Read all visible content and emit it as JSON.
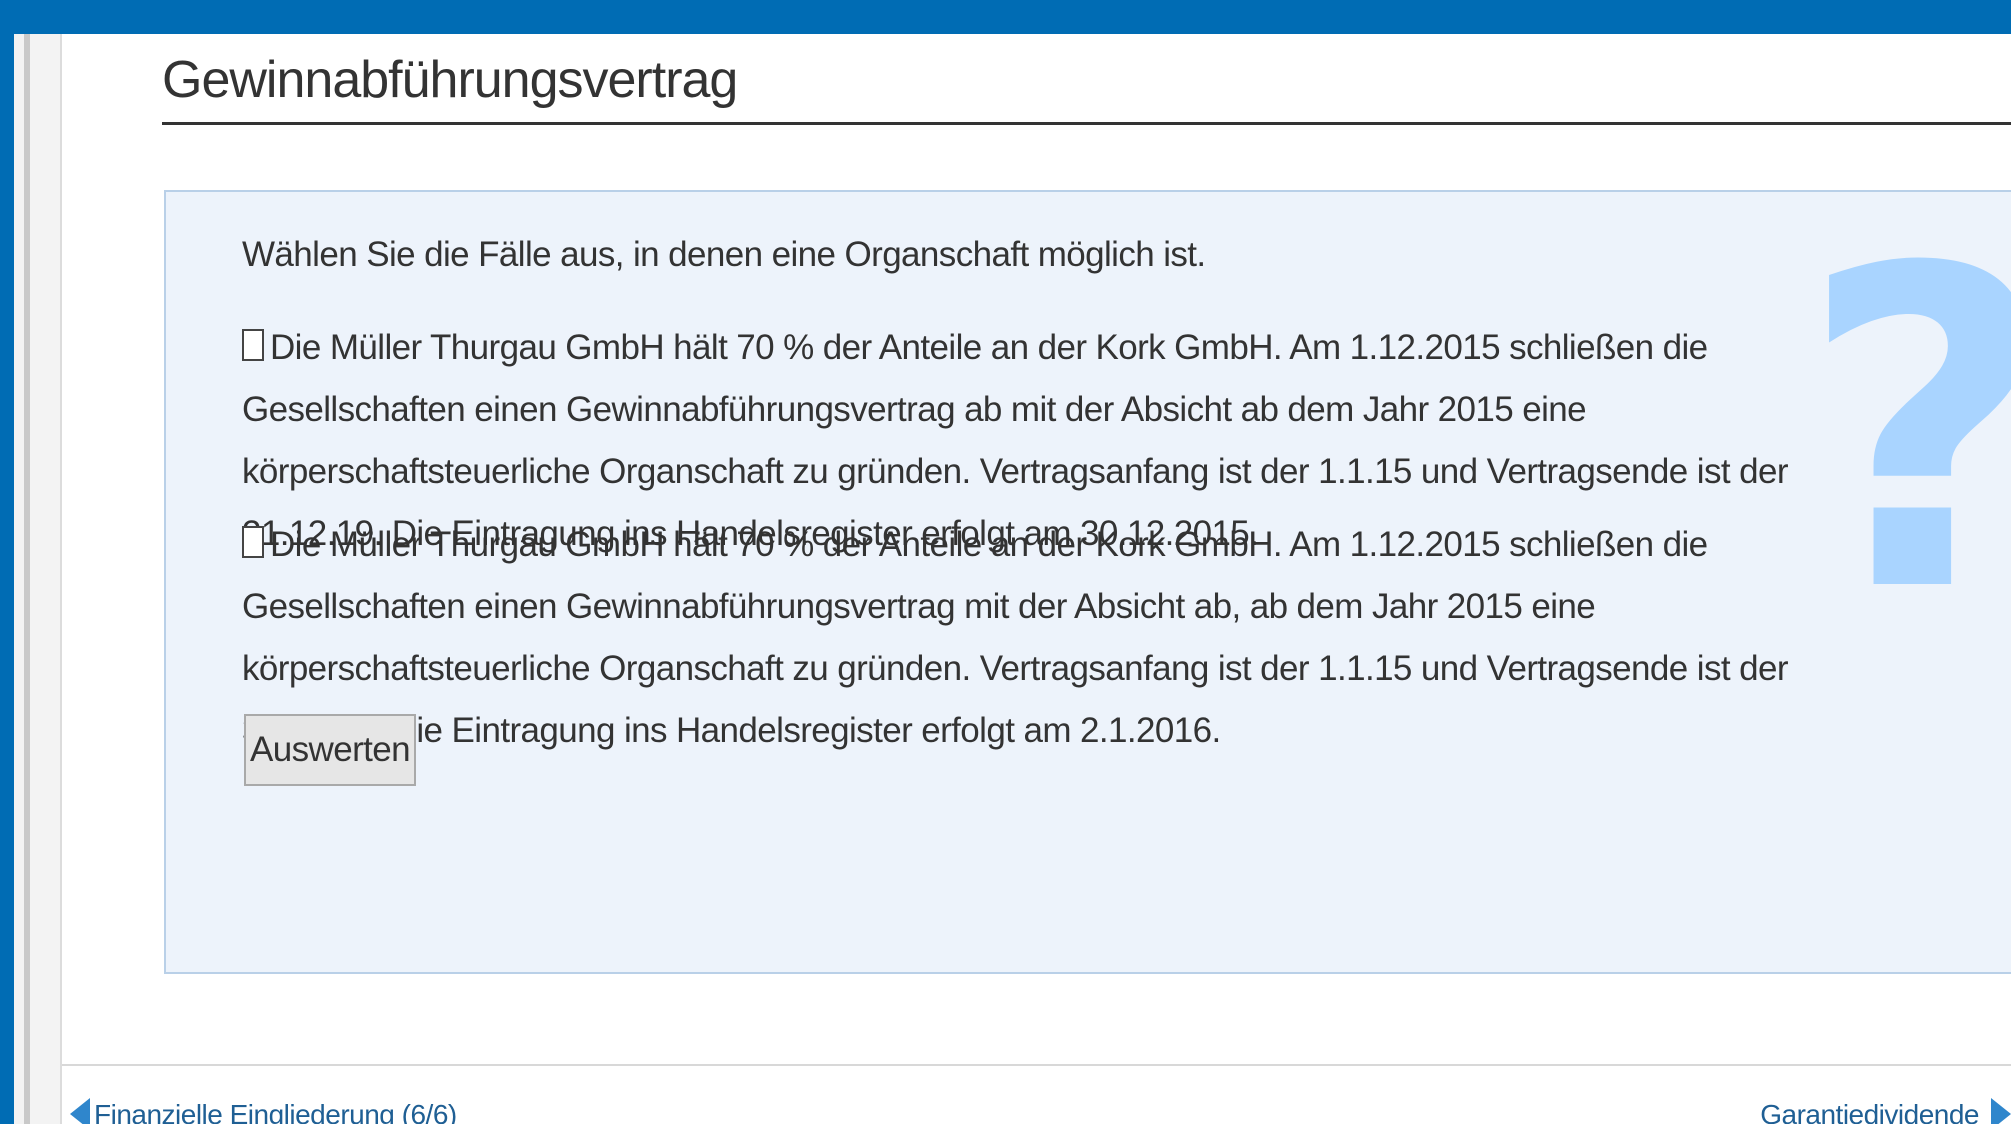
{
  "page": {
    "title": "Gewinnabführungsvertrag"
  },
  "question": {
    "prompt": "Wählen Sie die Fälle aus, in denen eine Organschaft möglich ist.",
    "options": [
      {
        "label": "Die Müller Thurgau GmbH hält 70 % der Anteile an der Kork GmbH. Am 1.12.2015 schließen die Gesellschaften einen Gewinnabführungsvertrag ab mit der Absicht ab dem Jahr 2015 eine körperschaftsteuerliche Organschaft zu gründen. Vertragsanfang ist der 1.1.15 und Vertragsende ist der 31.12.19. Die Eintragung ins Handelsregister erfolgt am 30.12.2015.",
        "checked": false
      },
      {
        "label": "Die Müller Thurgau GmbH hält 70 % der Anteile an der Kork GmbH. Am 1.12.2015 schließen die Gesellschaften einen Gewinnabführungsvertrag mit der Absicht ab, ab dem Jahr 2015 eine körperschaftsteuerliche Organschaft zu gründen. Vertragsanfang ist der 1.1.15 und Vertragsende ist der 31.12.19. Die Eintragung ins Handelsregister erfolgt am 2.1.2016.",
        "checked": false
      }
    ],
    "submit_label": "Auswerten",
    "decoration_glyph": "?"
  },
  "navigation": {
    "prev_label": "Finanzielle Eingliederung (6/6)",
    "next_label": "Garantiedividende"
  },
  "colors": {
    "header_bar": "#006cb4",
    "panel_background": "#edf3fb",
    "question_mark": "#a9d4ff",
    "nav_link": "#1f5f94"
  },
  "icons": {
    "decoration": "question-mark-icon",
    "prev": "arrow-left-icon",
    "next": "arrow-right-icon"
  }
}
